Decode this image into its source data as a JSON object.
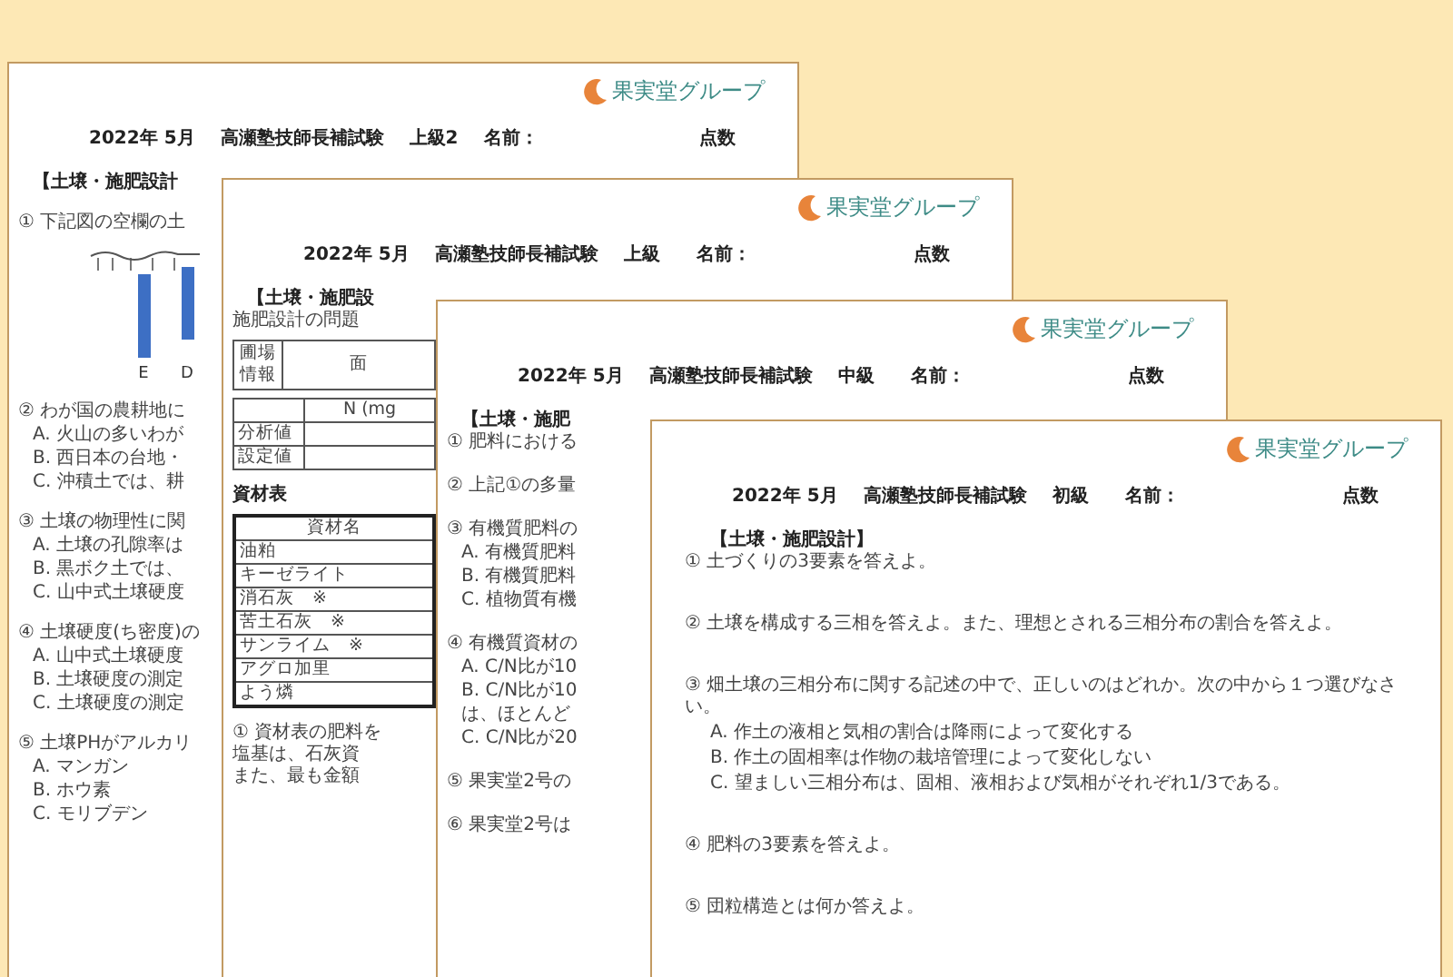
{
  "sheets": [
    {
      "logo": "果実堂グループ",
      "header": {
        "date": "2022年 5月",
        "title": "高瀬塾技師長補試験",
        "level": "上級2",
        "name_label": "名前：",
        "score_label": "点数"
      },
      "body": [
        {
          "kind": "heading",
          "text": "【土壌・施肥設計"
        },
        {
          "kind": "question",
          "text": "① 下記図の空欄の土"
        },
        {
          "kind": "diagram",
          "labels": [
            "E",
            "D"
          ]
        },
        {
          "kind": "question",
          "text": "② わが国の農耕地に"
        },
        {
          "kind": "choice",
          "text": "A. 火山の多いわが"
        },
        {
          "kind": "choice",
          "text": "B. 西日本の台地・"
        },
        {
          "kind": "choice",
          "text": "C. 沖積土では、耕"
        },
        {
          "kind": "question",
          "text": "③ 土壌の物理性に関"
        },
        {
          "kind": "choice",
          "text": "A. 土壌の孔隙率は"
        },
        {
          "kind": "choice",
          "text": "B. 黒ボク土では、"
        },
        {
          "kind": "choice",
          "text": "C. 山中式土壌硬度"
        },
        {
          "kind": "question",
          "text": "④ 土壌硬度(ち密度)の"
        },
        {
          "kind": "choice",
          "text": "A. 山中式土壌硬度"
        },
        {
          "kind": "choice",
          "text": "B. 土壌硬度の測定"
        },
        {
          "kind": "choice",
          "text": "C. 土壌硬度の測定"
        },
        {
          "kind": "question",
          "text": "⑤ 土壌PHがアルカリ"
        },
        {
          "kind": "choice",
          "text": "A. マンガン"
        },
        {
          "kind": "choice",
          "text": "B. ホウ素"
        },
        {
          "kind": "choice",
          "text": "C. モリブデン"
        }
      ]
    },
    {
      "logo": "果実堂グループ",
      "header": {
        "date": "2022年 5月",
        "title": "高瀬塾技師長補試験",
        "level": "上級",
        "name_label": "名前：",
        "score_label": "点数"
      },
      "body": [
        {
          "kind": "heading",
          "text": "【土壌・施肥設"
        },
        {
          "kind": "line",
          "text": "施肥設計の問題"
        },
        {
          "kind": "table",
          "corner": false,
          "thick": false,
          "head": [
            "圃場情報",
            "面"
          ]
        },
        {
          "kind": "table",
          "corner": true,
          "thick": false,
          "head": [
            "N (mg"
          ],
          "rows": [
            "分析値",
            "設定値"
          ]
        },
        {
          "kind": "label",
          "text": "資材表"
        },
        {
          "kind": "table",
          "corner": false,
          "thick": true,
          "head": [
            "資材名"
          ],
          "rows": [
            "油粕",
            "キーゼライト",
            "消石灰　※",
            "苦土石灰　※",
            "サンライム　※",
            "アグロ加里",
            "よう燐"
          ]
        },
        {
          "kind": "question",
          "text": "① 資材表の肥料を"
        },
        {
          "kind": "line",
          "text": "塩基は、石灰資"
        },
        {
          "kind": "line",
          "text": "また、最も金額"
        }
      ]
    },
    {
      "logo": "果実堂グループ",
      "header": {
        "date": "2022年 5月",
        "title": "高瀬塾技師長補試験",
        "level": "中級",
        "name_label": "名前：",
        "score_label": "点数"
      },
      "body": [
        {
          "kind": "heading",
          "text": "【土壌・施肥"
        },
        {
          "kind": "line",
          "text": "① 肥料における"
        },
        {
          "kind": "question",
          "text": "② 上記①の多量"
        },
        {
          "kind": "question",
          "text": "③ 有機質肥料の"
        },
        {
          "kind": "choice",
          "text": "A. 有機質肥料"
        },
        {
          "kind": "choice",
          "text": "B. 有機質肥料"
        },
        {
          "kind": "choice",
          "text": "C. 植物質有機"
        },
        {
          "kind": "question",
          "text": "④ 有機質資材の"
        },
        {
          "kind": "choice",
          "text": "A. C/N比が10"
        },
        {
          "kind": "choice",
          "text": "B. C/N比が10"
        },
        {
          "kind": "choice",
          "text": "は、ほとんど"
        },
        {
          "kind": "choice",
          "text": "C. C/N比が20"
        },
        {
          "kind": "question",
          "text": "⑤ 果実堂2号の"
        },
        {
          "kind": "question",
          "text": "⑥ 果実堂2号は"
        }
      ]
    },
    {
      "logo": "果実堂グループ",
      "header": {
        "date": "2022年 5月",
        "title": "高瀬塾技師長補試験",
        "level": "初級",
        "name_label": "名前：",
        "score_label": "点数"
      },
      "body": [
        {
          "kind": "heading",
          "text": "【土壌・施肥設計】"
        },
        {
          "kind": "line",
          "text": "① 土づくりの3要素を答えよ。"
        },
        {
          "kind": "question",
          "text": "② 土壌を構成する三相を答えよ。また、理想とされる三相分布の割合を答えよ。"
        },
        {
          "kind": "question",
          "text": "③ 畑土壌の三相分布に関する記述の中で、正しいのはどれか。次の中から１つ選びなさい。"
        },
        {
          "kind": "choice",
          "text": "A. 作土の液相と気相の割合は降雨によって変化する"
        },
        {
          "kind": "choice",
          "text": "B. 作土の固相率は作物の栽培管理によって変化しない"
        },
        {
          "kind": "choice",
          "text": "C. 望ましい三相分布は、固相、液相および気相がそれぞれ1/3である。"
        },
        {
          "kind": "question",
          "text": "④ 肥料の3要素を答えよ。"
        },
        {
          "kind": "question",
          "text": "⑤ 団粒構造とは何か答えよ。"
        }
      ]
    }
  ]
}
